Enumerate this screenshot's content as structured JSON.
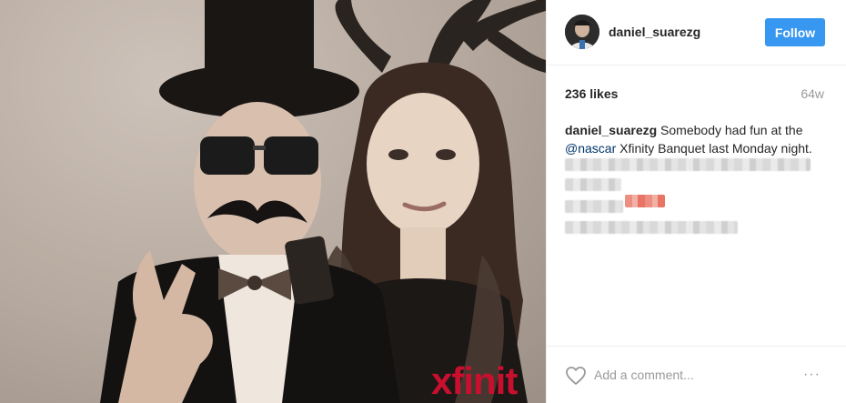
{
  "post": {
    "username": "daniel_suarezg",
    "follow_label": "Follow",
    "likes": "236 likes",
    "age": "64w",
    "caption": {
      "author": "daniel_suarezg",
      "text_before": "Somebody had fun at the",
      "mention": "@nascar",
      "text_after": "Xfinity Banquet last Monday night."
    },
    "photo_watermark": "xfinit"
  },
  "comment": {
    "placeholder": "Add a comment...",
    "more_label": "···"
  },
  "colors": {
    "follow_button": "#3897f0",
    "mention": "#003569",
    "muted": "#999999",
    "watermark": "#c8102e"
  },
  "icons": {
    "like": "heart-outline-icon",
    "more": "more-options-icon"
  }
}
